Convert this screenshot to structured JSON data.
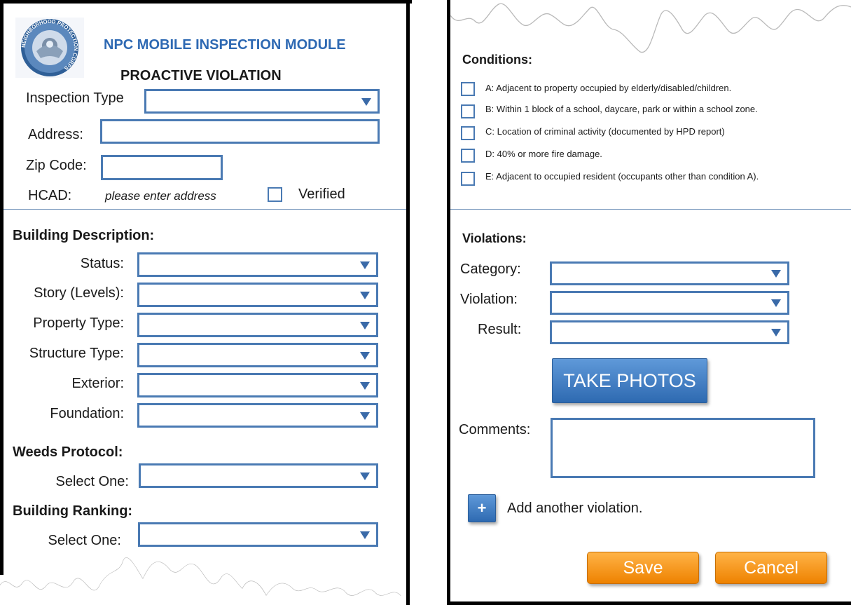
{
  "header": {
    "module_title": "NPC MOBILE INSPECTION MODULE",
    "form_title": "PROACTIVE VIOLATION",
    "logo_text": "NEIGHBORHOOD PROTECTION CORPS"
  },
  "inspection": {
    "type_label": "Inspection Type",
    "address_label": "Address:",
    "zip_label": "Zip Code:",
    "hcad_label": "HCAD:",
    "hcad_hint": "please enter address",
    "verified_label": "Verified"
  },
  "building": {
    "heading": "Building Description:",
    "status_label": "Status:",
    "story_label": "Story (Levels):",
    "property_type_label": "Property Type:",
    "structure_type_label": "Structure Type:",
    "exterior_label": "Exterior:",
    "foundation_label": "Foundation:"
  },
  "weeds": {
    "heading": "Weeds Protocol:",
    "select_label": "Select One:"
  },
  "ranking": {
    "heading": "Building Ranking:",
    "select_label": "Select One:"
  },
  "conditions": {
    "heading": "Conditions:",
    "items": [
      "A: Adjacent to property occupied by elderly/disabled/children.",
      "B: Within 1 block of a school, daycare, park or within a school zone.",
      "C: Location of criminal activity (documented by HPD report)",
      "D: 40% or more fire damage.",
      "E: Adjacent to occupied resident (occupants other than condition A)."
    ]
  },
  "violations": {
    "heading": "Violations:",
    "category_label": "Category:",
    "violation_label": "Violation:",
    "result_label": "Result:",
    "take_photos_label": "TAKE PHOTOS",
    "comments_label": "Comments:",
    "add_label": "Add another violation.",
    "plus_glyph": "+"
  },
  "actions": {
    "save_label": "Save",
    "cancel_label": "Cancel"
  },
  "colors": {
    "field_border": "#4a7ab3",
    "blue_button": "#3a77c2",
    "orange_button": "#f39312"
  }
}
